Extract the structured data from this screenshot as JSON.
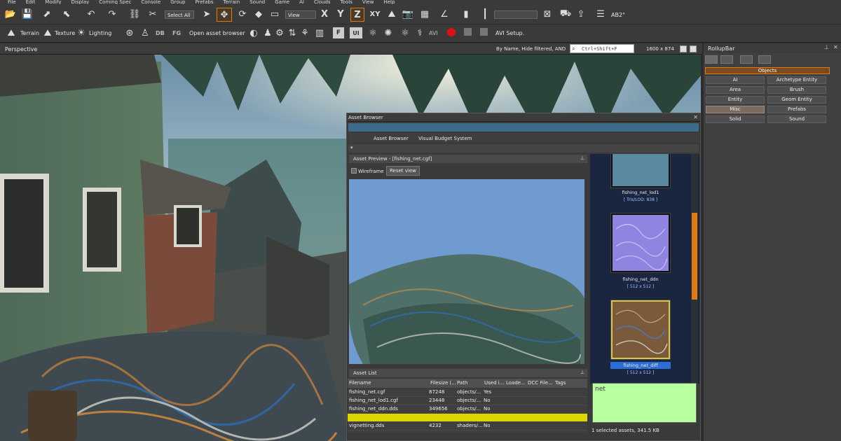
{
  "menu": [
    "File",
    "Edit",
    "Modify",
    "Display",
    "Coming Spec",
    "Console",
    "Group",
    "Prefabs",
    "Terrain",
    "Sound",
    "Game",
    "AI",
    "Clouds",
    "Tools",
    "View",
    "Help"
  ],
  "toolbar1": {
    "select_all": "Select All",
    "view_select": "View",
    "axis_labels": [
      "X",
      "Y",
      "Z",
      "XY"
    ],
    "snap_label": "AB2°"
  },
  "toolbar2": {
    "terrain": "Terrain",
    "texture": "Texture",
    "lighting": "Lighting",
    "db": "DB",
    "fg": "FG",
    "open_asset_browser": "Open asset browser",
    "avi": "AVI",
    "avi_setup": "AVI Setup."
  },
  "viewport": {
    "title": "Perspective",
    "filter_text": "By Name, Hide filtered, AND",
    "search_placeholder": "Ctrl+Shift+F",
    "resolution": "1600 x 874"
  },
  "rollupbar": {
    "title": "RollupBar",
    "section": "Objects",
    "buttons": [
      {
        "label": "AI",
        "selected": false
      },
      {
        "label": "Archetype Entity",
        "selected": false
      },
      {
        "label": "Area",
        "selected": false
      },
      {
        "label": "Brush",
        "selected": false
      },
      {
        "label": "Entity",
        "selected": false
      },
      {
        "label": "Geom Entity",
        "selected": false
      },
      {
        "label": "Misc",
        "selected": true
      },
      {
        "label": "Prefabs",
        "selected": false
      },
      {
        "label": "Solid",
        "selected": false
      },
      {
        "label": "Sound",
        "selected": false
      }
    ]
  },
  "asset_browser": {
    "title": "Asset Browser",
    "tabs": [
      "Asset Browser",
      "Visual Budget System"
    ],
    "preview_title": "Asset Preview - [fishing_net.cgf]",
    "wireframe": "Wireframe",
    "reset_view": "Reset view",
    "list_title": "Asset List",
    "columns": [
      "Filename",
      "Filesize (...",
      "Path",
      "Used i...",
      "Loade...",
      "DCC File...",
      "Tags"
    ],
    "rows": [
      {
        "name": "fishing_net.cgf",
        "size": "87248",
        "path": "objects/...",
        "used": "Yes",
        "highlight": false
      },
      {
        "name": "fishing_net_lod1.cgf",
        "size": "23448",
        "path": "objects/...",
        "used": "No",
        "highlight": false
      },
      {
        "name": "fishing_net_ddn.dds",
        "size": "349656",
        "path": "objects/...",
        "used": "No",
        "highlight": false
      },
      {
        "name": "",
        "size": "",
        "path": "",
        "used": "",
        "highlight": true
      },
      {
        "name": "vignetting.dds",
        "size": "4232",
        "path": "shaders/...",
        "used": "No",
        "highlight": false
      }
    ],
    "thumbs": [
      {
        "name": "fishing_net_lod1",
        "info": "[ Tris/LOD: 838 ]"
      },
      {
        "name": "fishing_net_ddn",
        "info": "[ 512 x 512 ]"
      },
      {
        "name": "fishing_net_diff",
        "info": "[ 512 x 512 ]"
      }
    ],
    "search_value": "net",
    "status": "1 selected assets, 341.5 KB"
  },
  "colors": {
    "accent_orange": "#e07a10",
    "selected_blue": "#2b6fd6",
    "highlight_yellow": "#d9d600",
    "search_green": "#b7ff9f",
    "preview_sky": "#6f9bd1"
  }
}
